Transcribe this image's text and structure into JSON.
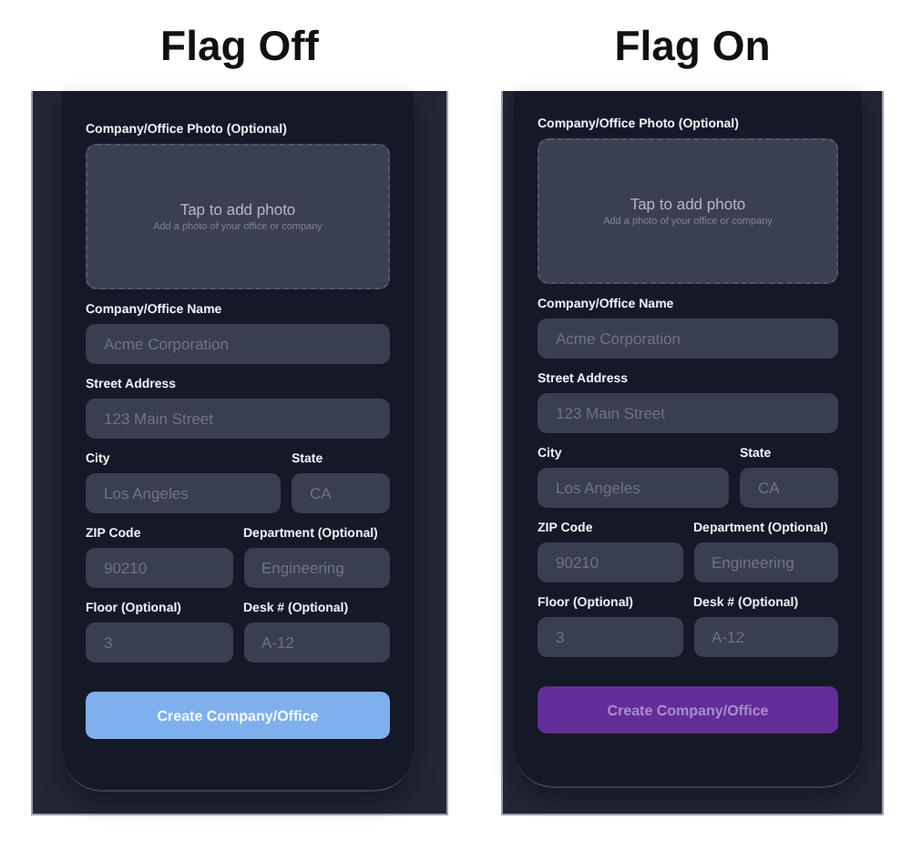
{
  "panels": [
    {
      "title": "Flag Off",
      "flag_on": false,
      "photo": {
        "label": "Company/Office Photo (Optional)",
        "prompt": "Tap to add photo",
        "hint": "Add a photo of your office or company"
      },
      "rows": [
        [
          {
            "label": "Company/Office Name",
            "placeholder": "Acme Corporation"
          }
        ],
        [
          {
            "label": "Street Address",
            "placeholder": "123 Main Street"
          }
        ],
        [
          {
            "label": "City",
            "placeholder": "Los Angeles"
          },
          {
            "label": "State",
            "placeholder": "CA"
          }
        ],
        [
          {
            "label": "ZIP Code",
            "placeholder": "90210"
          },
          {
            "label": "Department (Optional)",
            "placeholder": "Engineering"
          }
        ],
        [
          {
            "label": "Floor (Optional)",
            "placeholder": "3"
          },
          {
            "label": "Desk # (Optional)",
            "placeholder": "A-12"
          }
        ]
      ],
      "button": "Create Company/Office"
    },
    {
      "title": "Flag On",
      "flag_on": true,
      "photo": {
        "label": "Company/Office Photo (Optional)",
        "prompt": "Tap to add photo",
        "hint": "Add a photo of your office or company"
      },
      "rows": [
        [
          {
            "label": "Company/Office Name",
            "placeholder": "Acme Corporation"
          }
        ],
        [
          {
            "label": "Street Address",
            "placeholder": "123 Main Street"
          }
        ],
        [
          {
            "label": "City",
            "placeholder": "Los Angeles"
          },
          {
            "label": "State",
            "placeholder": "CA"
          }
        ],
        [
          {
            "label": "ZIP Code",
            "placeholder": "90210"
          },
          {
            "label": "Department (Optional)",
            "placeholder": "Engineering"
          }
        ],
        [
          {
            "label": "Floor (Optional)",
            "placeholder": "3"
          },
          {
            "label": "Desk # (Optional)",
            "placeholder": "A-12"
          }
        ]
      ],
      "button": "Create Company/Office"
    }
  ]
}
